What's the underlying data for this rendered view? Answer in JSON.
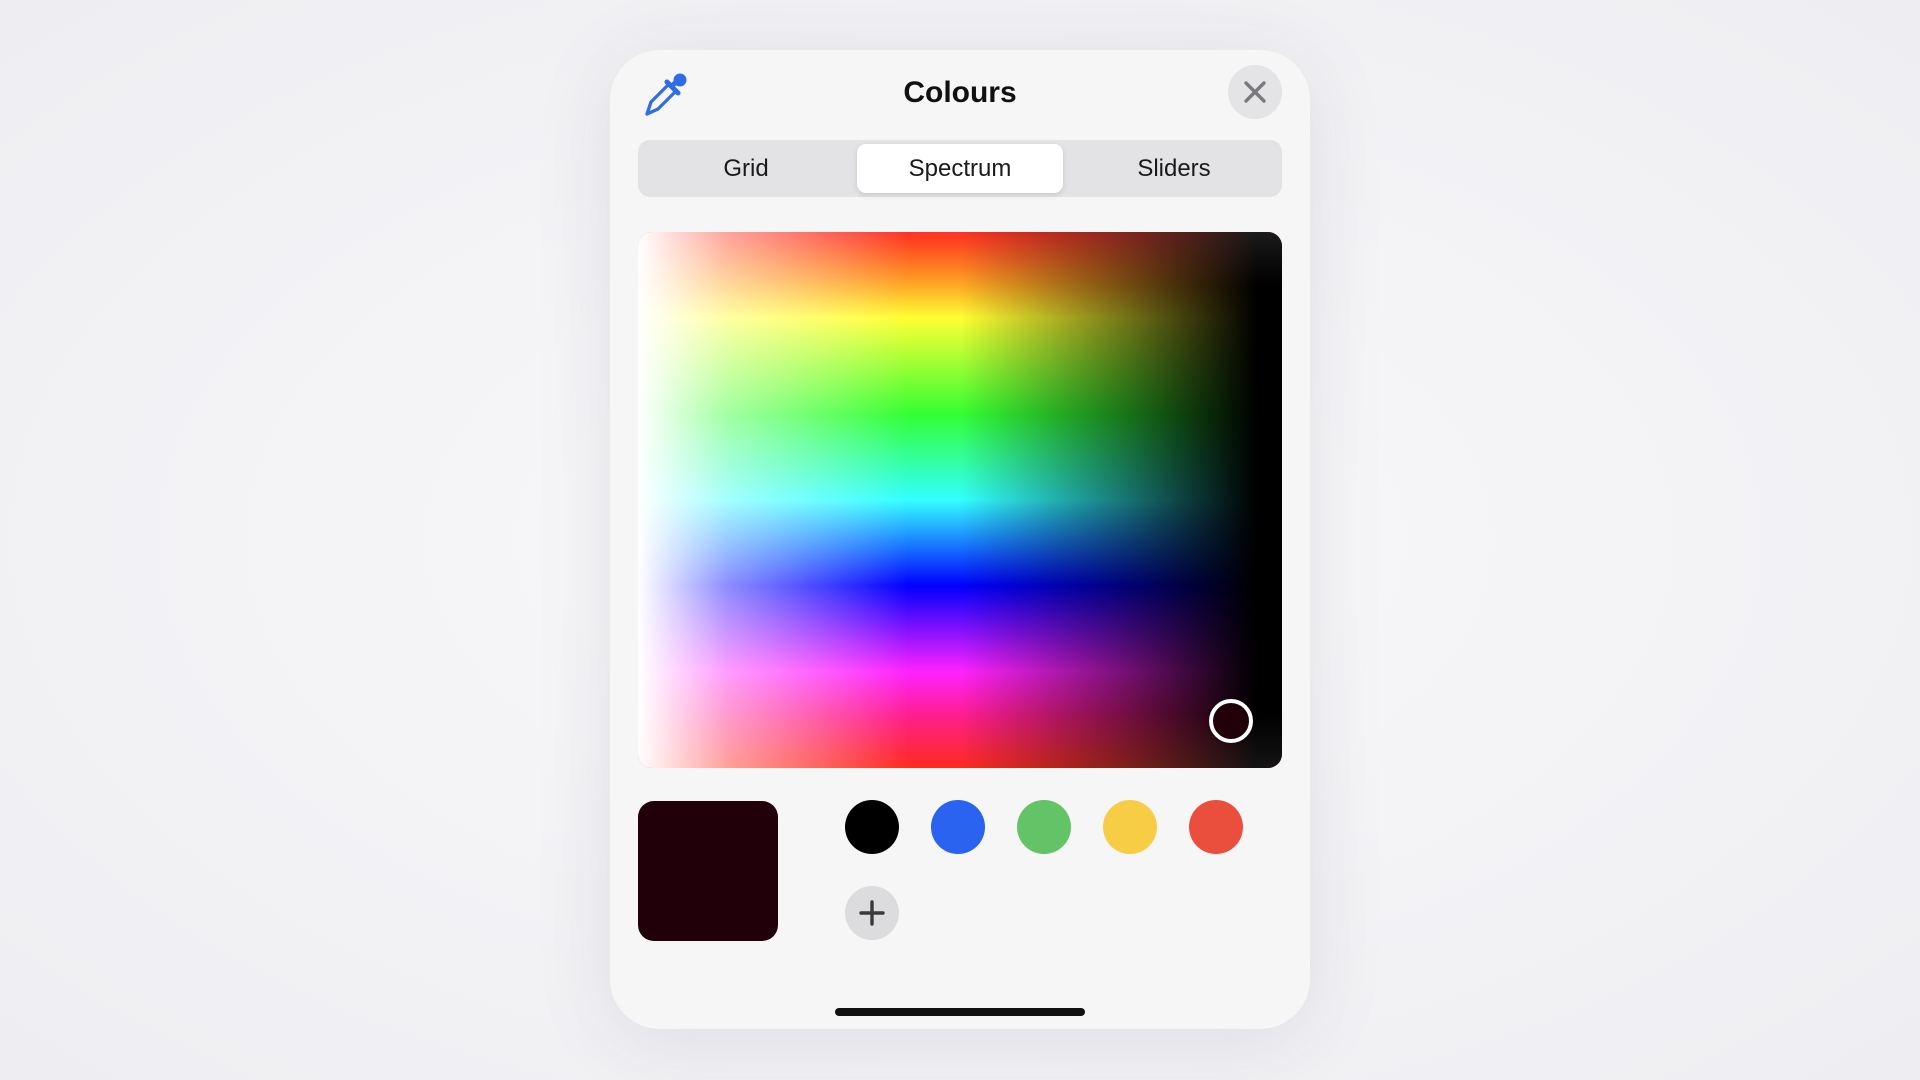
{
  "window": {
    "title": "Colours"
  },
  "header": {
    "eyedropper_icon": "eyedropper-icon",
    "close_icon": "close-icon"
  },
  "tabs": [
    {
      "label": "Grid",
      "selected": false
    },
    {
      "label": "Spectrum",
      "selected": true
    },
    {
      "label": "Sliders",
      "selected": false
    }
  ],
  "colors": {
    "accent": "#2f6ce5",
    "selected": "#220009",
    "presets": [
      "#000000",
      "#2a63f0",
      "#62c466",
      "#f8cd46",
      "#ea4e3d"
    ]
  },
  "add_icon": "plus-icon"
}
